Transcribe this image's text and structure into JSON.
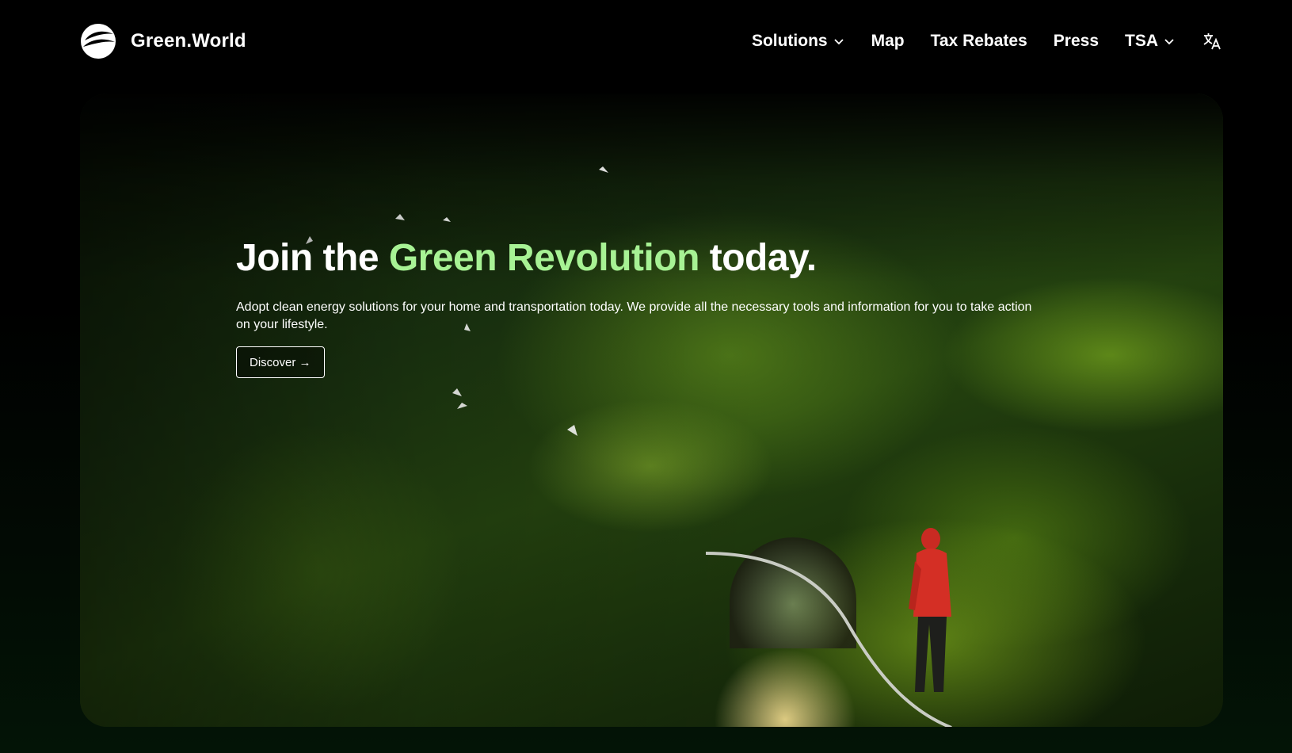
{
  "brand": {
    "name": "Green.World"
  },
  "nav": {
    "items": [
      {
        "label": "Solutions",
        "dropdown": true
      },
      {
        "label": "Map",
        "dropdown": false
      },
      {
        "label": "Tax Rebates",
        "dropdown": false
      },
      {
        "label": "Press",
        "dropdown": false
      },
      {
        "label": "TSA",
        "dropdown": true
      }
    ],
    "language_icon": "translate-icon"
  },
  "hero": {
    "headline_start": "Join the ",
    "headline_accent": "Green Revolution",
    "headline_end": " today.",
    "description": "Adopt clean energy solutions for your home and transportation today. We provide all the necessary tools and information for you to take action on your lifestyle.",
    "cta_label": "Discover →"
  },
  "colors": {
    "accent": "#a7f294",
    "background": "#000000"
  }
}
